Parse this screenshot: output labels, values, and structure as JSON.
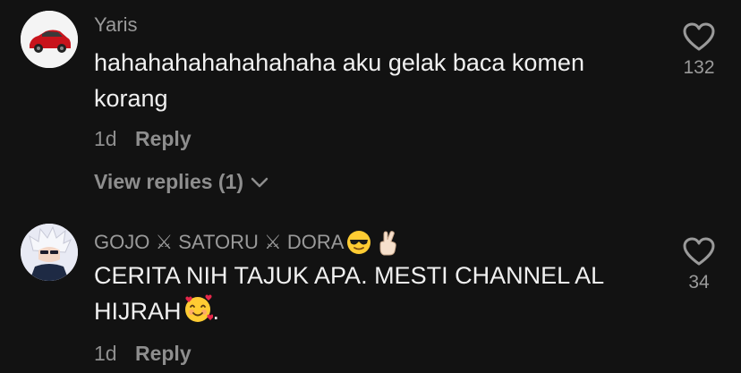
{
  "comments": [
    {
      "username": "Yaris",
      "text_line1": "hahahahahahahahaha aku gelak baca komen",
      "text_line2": "korang",
      "time": "1d",
      "reply_label": "Reply",
      "likes": "132",
      "view_replies": "View replies (1)"
    },
    {
      "username": "GOJO ⚔ SATORU ⚔ DORA",
      "text_line1": "CERITA NIH TAJUK APA. MESTI CHANNEL AL",
      "text_line2": "HIJRAH",
      "text_suffix": ".",
      "time": "1d",
      "reply_label": "Reply",
      "likes": "34"
    }
  ],
  "icons": {
    "like": "heart-outline-icon",
    "expand": "chevron-down-icon",
    "emoji_sunglasses": "smiling-face-with-sunglasses",
    "emoji_crossed_fingers": "crossed-fingers",
    "emoji_hearts": "smiling-face-with-hearts"
  },
  "colors": {
    "background": "#121212",
    "username": "#9a9a9a",
    "text": "#f0f0f0",
    "meta": "#8e8e8e"
  }
}
